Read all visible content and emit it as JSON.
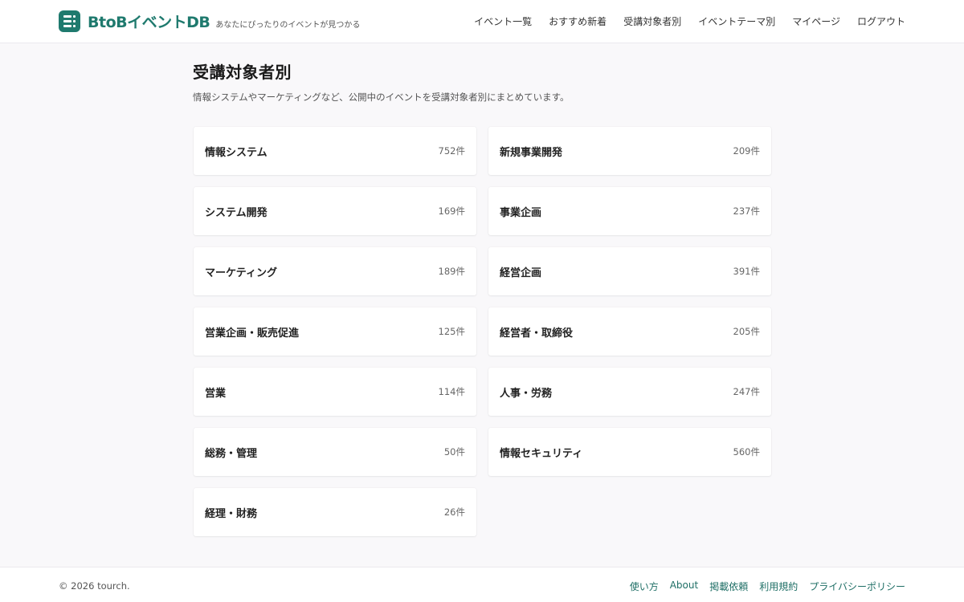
{
  "header": {
    "logo_icon": "database-list-icon",
    "brand": "BtoBイベントDB",
    "tagline": "あなたにぴったりのイベントが見つかる",
    "nav": [
      "イベント一覧",
      "おすすめ新着",
      "受講対象者別",
      "イベントテーマ別",
      "マイページ",
      "ログアウト"
    ]
  },
  "main": {
    "title": "受講対象者別",
    "description": "情報システムやマーケティングなど、公開中のイベントを受講対象者別にまとめています。",
    "categories": [
      {
        "name": "情報システム",
        "count": "752件"
      },
      {
        "name": "新規事業開発",
        "count": "209件"
      },
      {
        "name": "システム開発",
        "count": "169件"
      },
      {
        "name": "事業企画",
        "count": "237件"
      },
      {
        "name": "マーケティング",
        "count": "189件"
      },
      {
        "name": "経営企画",
        "count": "391件"
      },
      {
        "name": "営業企画・販売促進",
        "count": "125件"
      },
      {
        "name": "経営者・取締役",
        "count": "205件"
      },
      {
        "name": "営業",
        "count": "114件"
      },
      {
        "name": "人事・労務",
        "count": "247件"
      },
      {
        "name": "総務・管理",
        "count": "50件"
      },
      {
        "name": "情報セキュリティ",
        "count": "560件"
      },
      {
        "name": "経理・財務",
        "count": "26件"
      }
    ]
  },
  "footer": {
    "copyright": "© 2026 tourch.",
    "links": [
      "使い方",
      "About",
      "掲載依頼",
      "利用規約",
      "プライバシーポリシー"
    ]
  },
  "colors": {
    "brand": "#1f7a6e",
    "link": "#1f6f66",
    "background": "#f9f8fa"
  }
}
